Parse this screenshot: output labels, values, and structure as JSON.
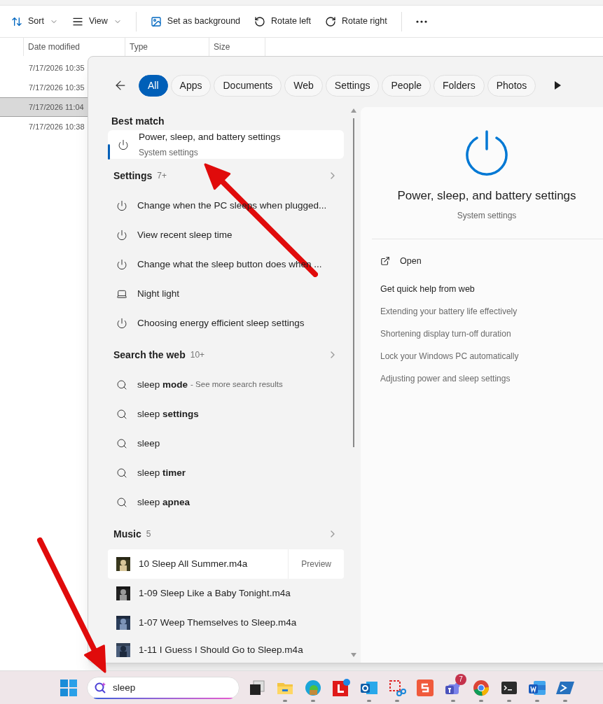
{
  "toolbar": [
    {
      "kind": "sort",
      "label": "Sort",
      "dropdown": true
    },
    {
      "kind": "view",
      "label": "View",
      "dropdown": true
    },
    {
      "kind": "background",
      "label": "Set as background",
      "dropdown": false
    },
    {
      "kind": "rotate-left",
      "label": "Rotate left",
      "dropdown": false
    },
    {
      "kind": "rotate-right",
      "label": "Rotate right",
      "dropdown": false
    },
    {
      "kind": "more",
      "dropdown": false
    }
  ],
  "file_list": {
    "columns": [
      "Date modified",
      "Type",
      "Size"
    ],
    "rows": [
      {
        "date": "7/17/2026 10:35",
        "selected": false
      },
      {
        "date": "7/17/2026 10:35",
        "selected": false
      },
      {
        "date": "7/17/2026 11:04",
        "selected": true
      },
      {
        "date": "7/17/2026 10:38",
        "selected": false
      }
    ]
  },
  "search_panel": {
    "filters": [
      {
        "label": "All",
        "selected": true
      },
      {
        "label": "Apps",
        "selected": false
      },
      {
        "label": "Documents",
        "selected": false
      },
      {
        "label": "Web",
        "selected": false
      },
      {
        "label": "Settings",
        "selected": false
      },
      {
        "label": "People",
        "selected": false
      },
      {
        "label": "Folders",
        "selected": false
      },
      {
        "label": "Photos",
        "selected": false
      }
    ],
    "best_match": {
      "heading": "Best match",
      "title": "Power, sleep, and battery settings",
      "subtitle": "System settings"
    },
    "sections": [
      {
        "title": "Settings",
        "count": "7+",
        "items": [
          {
            "kind": "power",
            "text": "Change when the PC sleeps when plugged..."
          },
          {
            "kind": "power",
            "text": "View recent sleep time"
          },
          {
            "kind": "power",
            "text": "Change what the sleep button does when ..."
          },
          {
            "kind": "display",
            "text": "Night light"
          },
          {
            "kind": "power",
            "text": "Choosing energy efficient sleep settings"
          }
        ]
      },
      {
        "title": "Search the web",
        "count": "10+",
        "items": [
          {
            "kind": "search",
            "text": "sleep **mode**",
            "hint": "- See more search results"
          },
          {
            "kind": "search",
            "text": "sleep **settings**"
          },
          {
            "kind": "search",
            "text": "sleep"
          },
          {
            "kind": "search",
            "text": "sleep **timer**"
          },
          {
            "kind": "search",
            "text": "sleep **apnea**"
          }
        ]
      },
      {
        "title": "Music",
        "count": "5",
        "items": [
          {
            "kind": "music",
            "text": "10 Sleep All Summer.m4a",
            "action": "Preview",
            "selected": true
          },
          {
            "kind": "music",
            "text": "1-09 Sleep Like a Baby Tonight.m4a",
            "selected": false
          },
          {
            "kind": "music",
            "text": "1-07 Weep Themselves to Sleep.m4a",
            "selected": false
          },
          {
            "kind": "music",
            "text": "1-11 I Guess I Should Go to Sleep.m4a",
            "selected": false
          }
        ]
      }
    ],
    "detail": {
      "title": "Power, sleep, and battery settings",
      "subtitle": "System settings",
      "open": "Open",
      "help_heading": "Get quick help from web",
      "links": [
        "Extending your battery life effectively",
        "Shortening display turn-off duration",
        "Lock your Windows PC automatically",
        "Adjusting power and sleep settings"
      ]
    }
  },
  "taskbar": {
    "search": {
      "value": "sleep"
    },
    "apps": [
      {
        "kind": "taskview",
        "running": false
      },
      {
        "kind": "explorer",
        "running": true
      },
      {
        "kind": "edge",
        "running": true
      },
      {
        "kind": "red-l",
        "running": false
      },
      {
        "kind": "outlook",
        "running": true
      },
      {
        "kind": "snip",
        "running": true
      },
      {
        "kind": "red-s",
        "running": false
      },
      {
        "kind": "teams",
        "running": true,
        "badge": "7"
      },
      {
        "kind": "chrome",
        "running": true
      },
      {
        "kind": "terminal",
        "running": true
      },
      {
        "kind": "word",
        "running": true
      },
      {
        "kind": "powershell",
        "running": true
      }
    ]
  }
}
